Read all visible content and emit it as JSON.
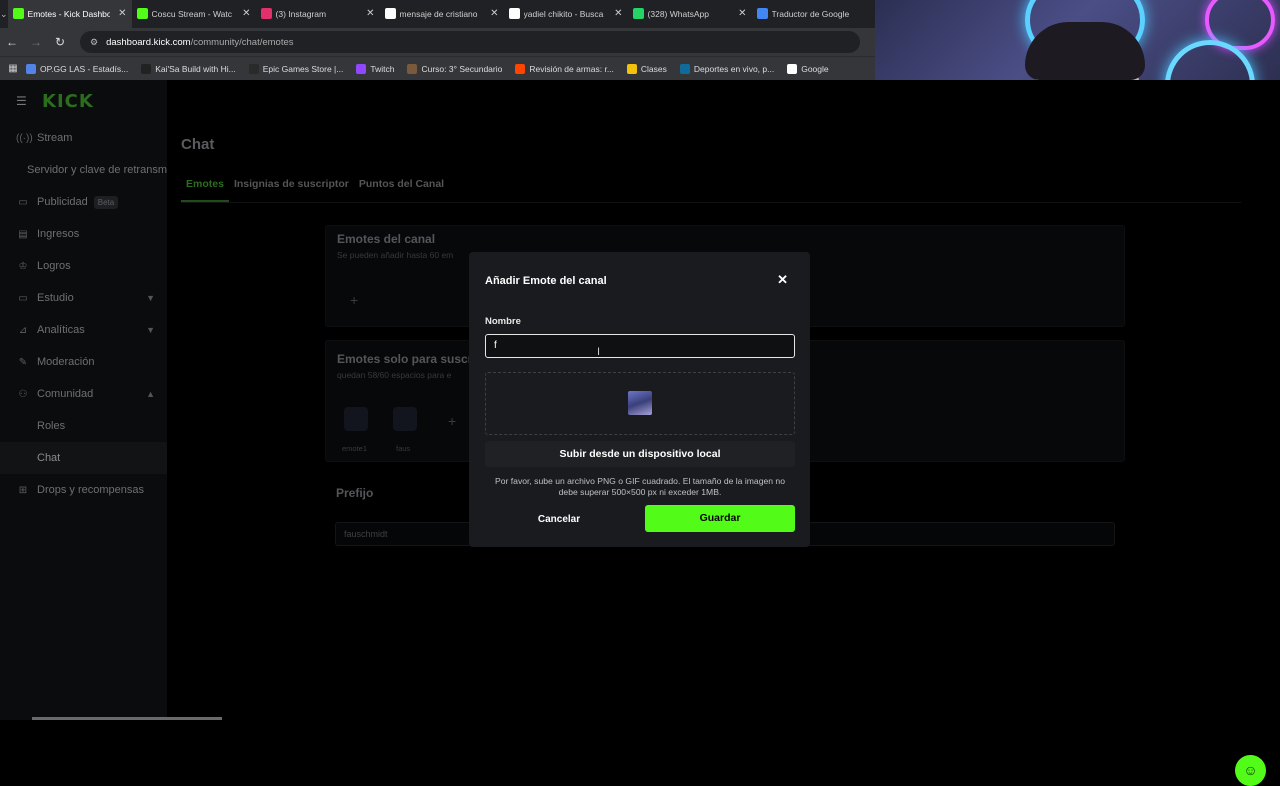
{
  "browser": {
    "tabs": [
      {
        "label": "Emotes - Kick Dashbo",
        "active": true,
        "icon": "kick-icon",
        "color": "#53fc18"
      },
      {
        "label": "Coscu Stream - Watc",
        "active": false,
        "icon": "kick-icon",
        "color": "#53fc18"
      },
      {
        "label": "(3) Instagram",
        "active": false,
        "icon": "instagram-icon",
        "color": "#e1306c"
      },
      {
        "label": "mensaje de cristiano",
        "active": false,
        "icon": "google-icon",
        "color": "#ffffff"
      },
      {
        "label": "yadiel chikito - Busca",
        "active": false,
        "icon": "google-icon",
        "color": "#ffffff"
      },
      {
        "label": "(328) WhatsApp",
        "active": false,
        "icon": "whatsapp-icon",
        "color": "#25d366"
      },
      {
        "label": "Traductor de Google",
        "active": false,
        "icon": "translate-icon",
        "color": "#4285f4"
      }
    ],
    "url_host": "dashboard.kick.com",
    "url_path": "/community/chat/emotes",
    "bookmarks": [
      {
        "label": "OP.GG LAS - Estadís...",
        "color": "#5383e8"
      },
      {
        "label": "Kai'Sa Build with Hi...",
        "color": "#222222"
      },
      {
        "label": "Epic Games Store |...",
        "color": "#2a2a2a"
      },
      {
        "label": "Twitch",
        "color": "#9146ff"
      },
      {
        "label": "Curso: 3° Secundario",
        "color": "#7a5a3a"
      },
      {
        "label": "Revisión de armas: r...",
        "color": "#ff4500"
      },
      {
        "label": "Clases",
        "color": "#f4c20d"
      },
      {
        "label": "Deportes en vivo, p...",
        "color": "#0f6c9a"
      },
      {
        "label": "Google",
        "color": "#ffffff"
      }
    ]
  },
  "sidebar": {
    "logo": "KICK",
    "items": [
      {
        "label": "Stream",
        "icon": "broadcast-icon"
      },
      {
        "label": "Servidor y clave de retransm",
        "sub": true
      },
      {
        "label": "Publicidad",
        "icon": "megaphone-icon",
        "badge": "Beta"
      },
      {
        "label": "Ingresos",
        "icon": "wallet-icon"
      },
      {
        "label": "Logros",
        "icon": "trophy-icon"
      },
      {
        "label": "Estudio",
        "icon": "studio-icon",
        "chevron": "down"
      },
      {
        "label": "Analíticas",
        "icon": "chart-icon",
        "chevron": "down"
      },
      {
        "label": "Moderación",
        "icon": "wrench-icon"
      },
      {
        "label": "Comunidad",
        "icon": "people-icon",
        "chevron": "up"
      },
      {
        "label": "Roles",
        "sub": true
      },
      {
        "label": "Chat",
        "sub": true,
        "active": true
      },
      {
        "label": "Drops y recompensas",
        "icon": "gift-icon"
      }
    ]
  },
  "main": {
    "title": "Chat",
    "tabs": [
      "Emotes",
      "Insignias de suscriptor",
      "Puntos del Canal"
    ],
    "channel_emotes": {
      "title": "Emotes del canal",
      "subtitle": "Se pueden añadir hasta 60 em"
    },
    "sub_emotes": {
      "title": "Emotes solo para suscr",
      "subtitle": "quedan 58/60 espacios para e",
      "emotes": [
        "emote1",
        "faus"
      ]
    },
    "prefix": {
      "title": "Prefijo",
      "value": "fauschmidt"
    }
  },
  "modal": {
    "title": "Añadir Emote del canal",
    "field_label": "Nombre",
    "field_value": "f",
    "upload_label": "Subir desde un dispositivo local",
    "help_text": "Por favor, sube un archivo PNG o GIF cuadrado. El tamaño de la imagen no debe superar 500×500 px ni exceder 1MB.",
    "cancel_label": "Cancelar",
    "save_label": "Guardar",
    "accent": "#53fc18"
  }
}
